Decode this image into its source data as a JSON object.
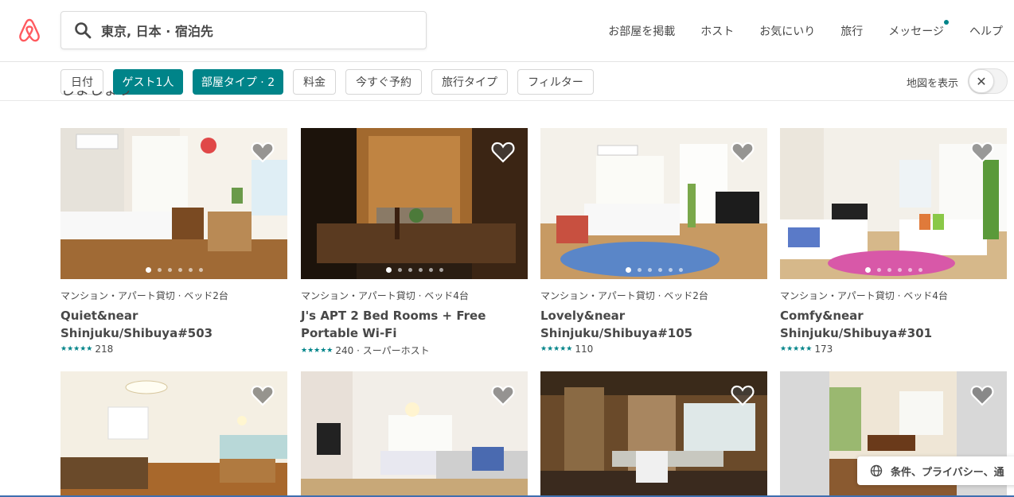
{
  "header": {
    "search_text": "東京, 日本 · 宿泊先",
    "nav": {
      "host_listing": "お部屋を掲載",
      "host": "ホスト",
      "saved": "お気にいり",
      "trips": "旅行",
      "messages": "メッセージ",
      "help": "ヘルプ"
    }
  },
  "filters": {
    "dates": "日付",
    "guests": "ゲスト1人",
    "room_type": "部屋タイプ · 2",
    "price": "料金",
    "instant_book": "今すぐ予約",
    "trip_type": "旅行タイプ",
    "more_filters": "フィルター",
    "show_map": "地図を表示",
    "toggle_icon": "✕"
  },
  "section_heading": "しましょう",
  "colors": {
    "accent": "#008489",
    "logo": "#ff5a5f"
  },
  "listings": [
    {
      "meta": "マンション・アパート貸切 · ベッド2台",
      "title": "Quiet&near Shinjuku/Shibuya#503",
      "stars": "★★★★★",
      "reviews": "218",
      "extra": ""
    },
    {
      "meta": "マンション・アパート貸切 · ベッド4台",
      "title": "J's APT 2 Bed Rooms + Free Portable Wi-Fi",
      "stars": "★★★★★",
      "reviews": "240 · スーパーホスト",
      "extra": ""
    },
    {
      "meta": "マンション・アパート貸切 · ベッド2台",
      "title": "Lovely&near Shinjuku/Shibuya#105",
      "stars": "★★★★★",
      "reviews": "110",
      "extra": ""
    },
    {
      "meta": "マンション・アパート貸切 · ベッド4台",
      "title": "Comfy&near Shinjuku/Shibuya#301",
      "stars": "★★★★★",
      "reviews": "173",
      "extra": ""
    }
  ],
  "footer_popup": "条件、プライバシー、通"
}
